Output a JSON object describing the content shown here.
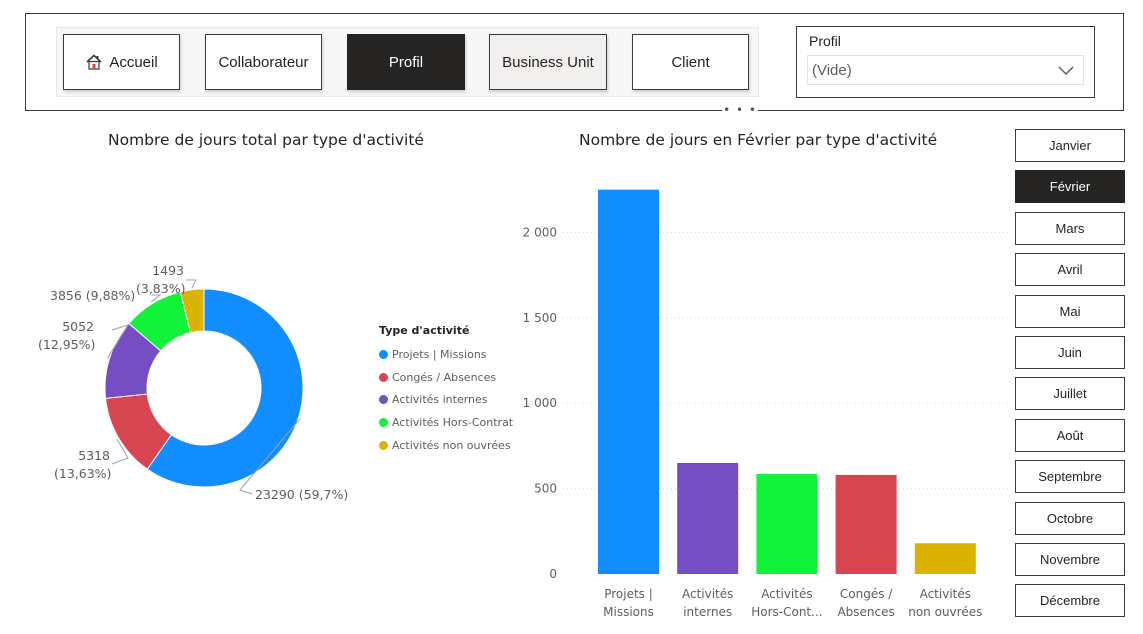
{
  "nav": {
    "buttons": [
      {
        "label": "Accueil",
        "icon": "home-icon",
        "state": "default"
      },
      {
        "label": "Collaborateur",
        "state": "default"
      },
      {
        "label": "Profil",
        "state": "active"
      },
      {
        "label": "Business Unit",
        "state": "soft"
      },
      {
        "label": "Client",
        "state": "default"
      }
    ],
    "more": "• • •"
  },
  "slicer": {
    "title": "Profil",
    "value": "(Vide)"
  },
  "colors": {
    "projets": "#118DFF",
    "conges": "#D64550",
    "internes": "#744EC2",
    "hors_contrat": "#11F23B",
    "non_ouvrees": "#D9B300",
    "active": "#252423"
  },
  "months": [
    "Janvier",
    "Février",
    "Mars",
    "Avril",
    "Mai",
    "Juin",
    "Juillet",
    "Août",
    "Septembre",
    "Octobre",
    "Novembre",
    "Décembre"
  ],
  "selected_month": "Février",
  "chart_data": [
    {
      "type": "pie",
      "title": "Nombre de jours total par type d'activité",
      "legend_title": "Type d'activité",
      "legend_position": "right",
      "slices": [
        {
          "name": "Projets | Missions",
          "value": 23290,
          "label": "23290 (59,7%)",
          "color": "#118DFF"
        },
        {
          "name": "Congés / Absences",
          "value": 5318,
          "label_lines": [
            "5318",
            "(13,63%)"
          ],
          "color": "#D64550"
        },
        {
          "name": "Activités internes",
          "value": 5052,
          "label_lines": [
            "5052",
            "(12,95%)"
          ],
          "color": "#744EC2"
        },
        {
          "name": "Activités Hors-Contrat",
          "value": 3856,
          "label": "3856 (9,88%)",
          "color": "#11F23B"
        },
        {
          "name": "Activités non ouvrées",
          "value": 1493,
          "label_lines": [
            "1493",
            "(3,83%)"
          ],
          "color": "#D9B300"
        }
      ]
    },
    {
      "type": "bar",
      "title": "Nombre de jours en Février par type d'activité",
      "categories": [
        [
          "Projets |",
          "Missions"
        ],
        [
          "Activités",
          "internes"
        ],
        [
          "Activités",
          "Hors-Cont..."
        ],
        [
          "Congés /",
          "Absences"
        ],
        [
          "Activités",
          "non ouvrées"
        ]
      ],
      "values": [
        2250,
        650,
        585,
        580,
        180
      ],
      "colors": [
        "#118DFF",
        "#744EC2",
        "#11F23B",
        "#D64550",
        "#D9B300"
      ],
      "yticks": [
        0,
        500,
        1000,
        1500,
        2000
      ],
      "ytick_labels": [
        "0",
        "500",
        "1 000",
        "1 500",
        "2 000"
      ],
      "ylim": [
        0,
        2400
      ],
      "grid": true
    }
  ]
}
